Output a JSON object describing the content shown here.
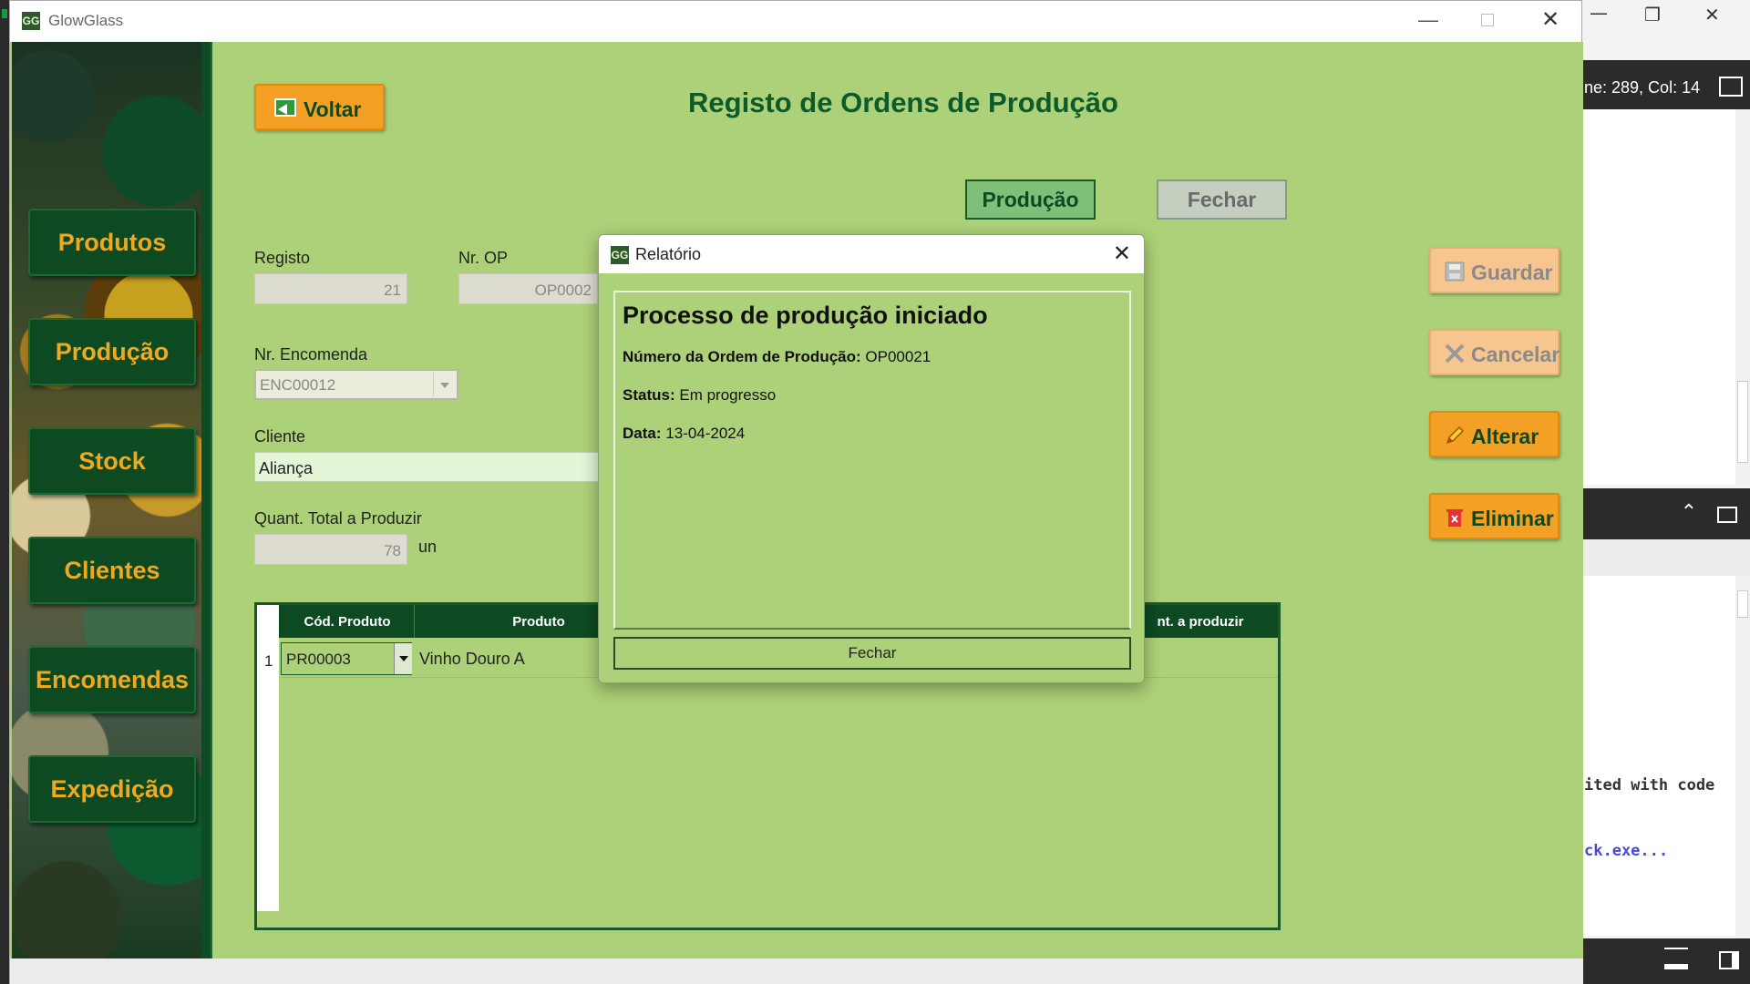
{
  "window": {
    "app_title": "GlowGlass",
    "icon_text": "GG"
  },
  "sidebar": {
    "items": [
      {
        "label": "Produtos"
      },
      {
        "label": "Produção"
      },
      {
        "label": "Stock"
      },
      {
        "label": "Clientes"
      },
      {
        "label": "Encomendas"
      },
      {
        "label": "Expedição"
      }
    ]
  },
  "header": {
    "back_label": "Voltar",
    "title": "Registo de Ordens de Produção",
    "producao_label": "Produção",
    "fechar_label": "Fechar"
  },
  "actions": {
    "guardar_label": "Guardar",
    "cancelar_label": "Cancelar",
    "alterar_label": "Alterar",
    "eliminar_label": "Eliminar"
  },
  "form": {
    "registo_label": "Registo",
    "registo_value": "21",
    "nr_op_label": "Nr. OP",
    "nr_op_value": "OP0002",
    "nr_encomenda_label": "Nr. Encomenda",
    "nr_encomenda_value": "ENC00012",
    "cliente_label": "Cliente",
    "cliente_value": "Aliança",
    "quant_total_label": "Quant. Total a Produzir",
    "quant_total_value": "78",
    "quant_unit": "un"
  },
  "grid": {
    "columns": [
      "Cód. Produto",
      "Produto",
      "nt. a produzir"
    ],
    "rows": [
      {
        "num": "1",
        "cod": "PR00003",
        "produto": "Vinho Douro A"
      }
    ]
  },
  "dialog": {
    "title": "Relatório",
    "heading": "Processo de produção iniciado",
    "op_label": "Número da Ordem de Produção:",
    "op_value": "OP00021",
    "status_label": "Status:",
    "status_value": "Em progresso",
    "data_label": "Data:",
    "data_value": "13-04-2024",
    "fechar_label": "Fechar"
  },
  "background_ide": {
    "status_text": "ne: 289, Col: 14",
    "terminal_line1": "ited with code",
    "terminal_line2": "ck.exe..."
  },
  "colors": {
    "app_bg": "#add178",
    "dark_green": "#0d4a22",
    "orange": "#f4a024",
    "nav_text": "#f0a820"
  }
}
